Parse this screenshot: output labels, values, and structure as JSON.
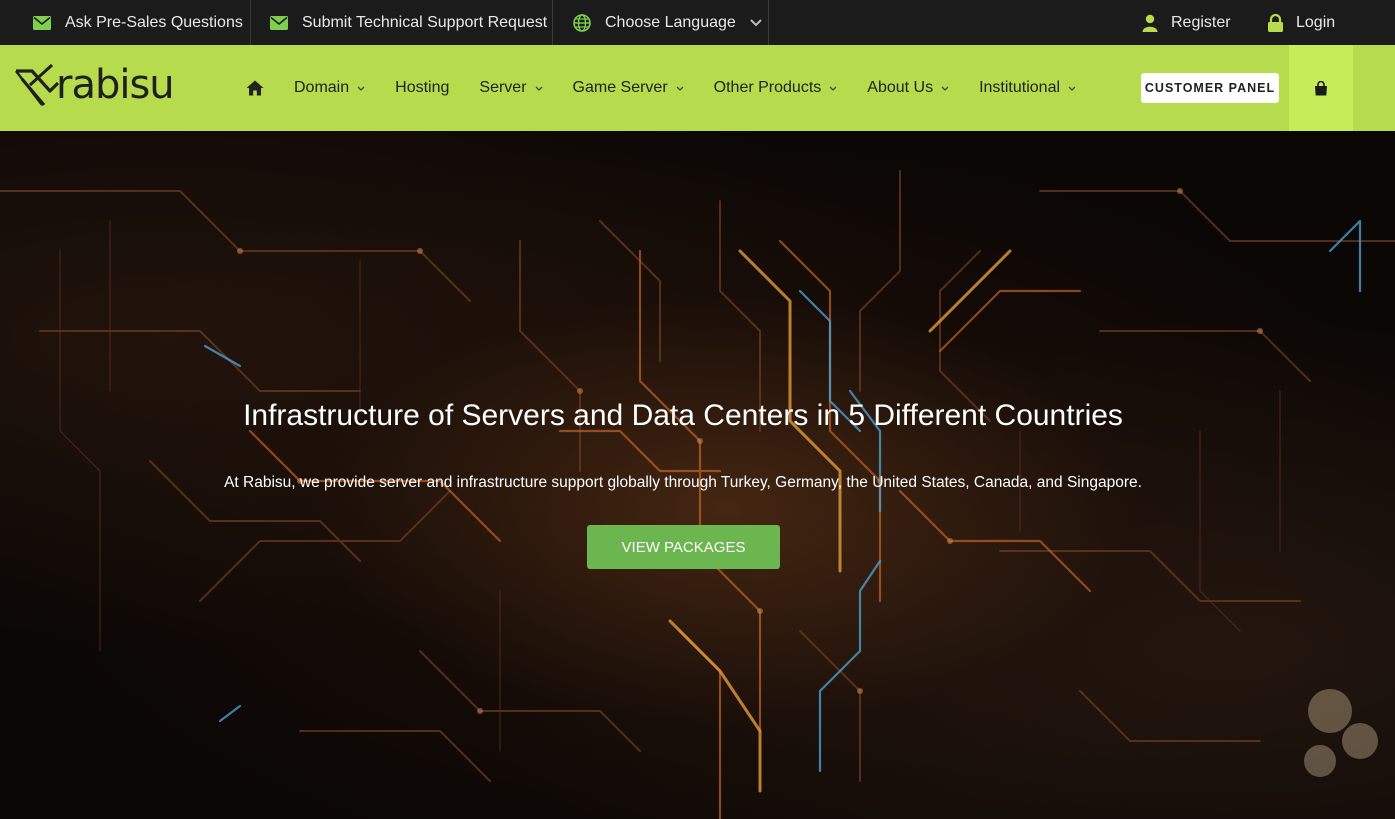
{
  "topbar": {
    "presales": "Ask Pre-Sales Questions",
    "support": "Submit Technical Support Request",
    "language": "Choose Language",
    "register": "Register",
    "login": "Login"
  },
  "logo": {
    "text": "rabisu"
  },
  "nav": {
    "items": [
      {
        "label": "Domain"
      },
      {
        "label": "Hosting"
      },
      {
        "label": "Server"
      },
      {
        "label": "Game Server"
      },
      {
        "label": "Other Products"
      },
      {
        "label": "About Us"
      },
      {
        "label": "Institutional"
      }
    ],
    "customer_panel": "CUSTOMER PANEL"
  },
  "hero": {
    "title": "Infrastructure of Servers and Data Centers in 5 Different Countries",
    "subtitle": "At Rabisu, we provide server and infrastructure support globally through Turkey, Germany, the United States, Canada, and Singapore.",
    "button": "VIEW PACKAGES"
  },
  "colors": {
    "accent": "#b6db4c",
    "button": "#6cb650",
    "topbar": "#1b1b1b"
  },
  "icons": [
    "envelope-icon",
    "globe-icon",
    "user-icon",
    "lock-icon",
    "home-icon",
    "shopping-bag-icon",
    "chevron-down-icon"
  ]
}
